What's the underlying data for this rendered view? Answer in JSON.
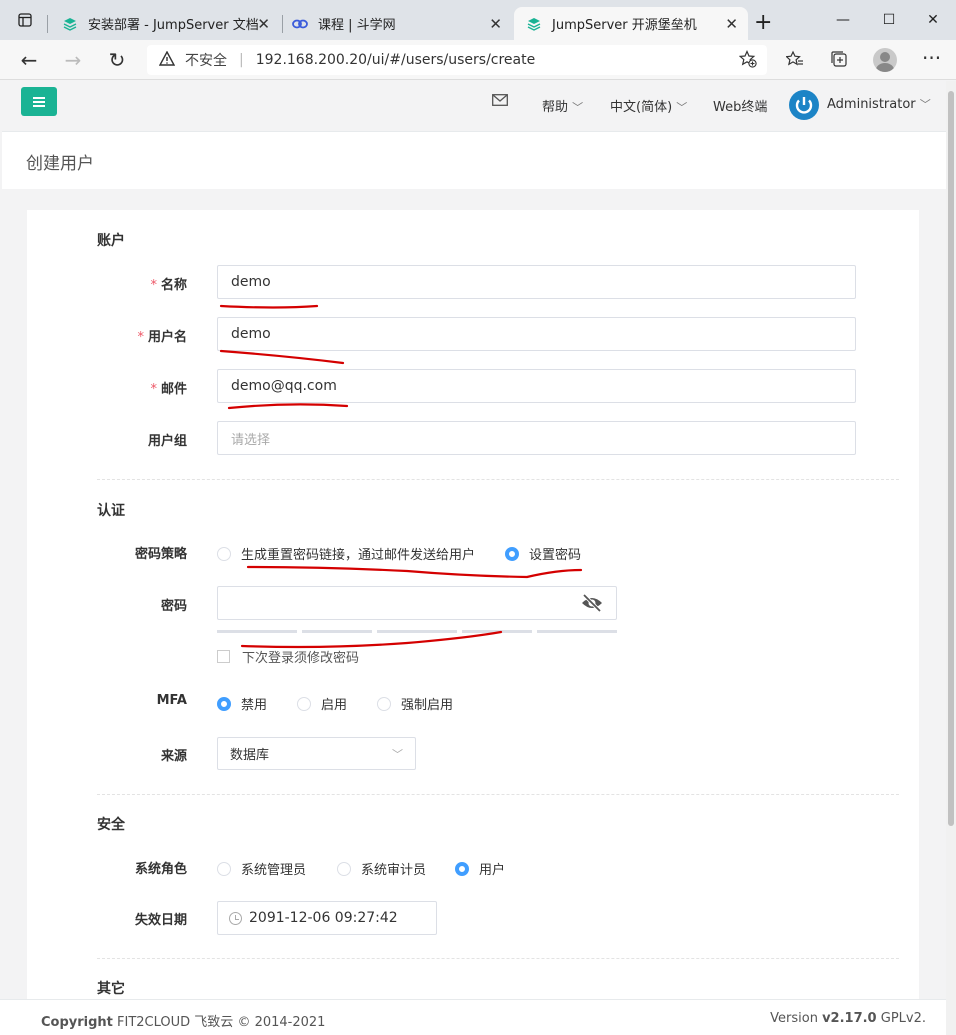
{
  "browser": {
    "tabs": [
      {
        "title": "安装部署 - JumpServer 文档",
        "icon": "jumpserver-doc-icon"
      },
      {
        "title": "课程 | 斗学网",
        "icon": "link-icon"
      },
      {
        "title": "JumpServer 开源堡垒机",
        "icon": "jumpserver-icon"
      }
    ],
    "security_label": "不安全",
    "url": "192.168.200.20/ui/#/users/users/create"
  },
  "topnav": {
    "help": "帮助",
    "lang": "中文(简体)",
    "web_terminal": "Web终端",
    "user": "Administrator"
  },
  "page_title": "创建用户",
  "sections": {
    "account": "账户",
    "auth": "认证",
    "security": "安全",
    "other": "其它"
  },
  "fields": {
    "name_label": "名称",
    "name_value": "demo",
    "username_label": "用户名",
    "username_value": "demo",
    "email_label": "邮件",
    "email_value": "demo@qq.com",
    "group_label": "用户组",
    "group_placeholder": "请选择",
    "password_strategy_label": "密码策略",
    "password_strategy_options": [
      "生成重置密码链接，通过邮件发送给用户",
      "设置密码"
    ],
    "password_strategy_selected": "设置密码",
    "password_label": "密码",
    "must_change_label": "下次登录须修改密码",
    "mfa_label": "MFA",
    "mfa_options": [
      "禁用",
      "启用",
      "强制启用"
    ],
    "mfa_selected": "禁用",
    "source_label": "来源",
    "source_value": "数据库",
    "role_label": "系统角色",
    "role_options": [
      "系统管理员",
      "系统审计员",
      "用户"
    ],
    "role_selected": "用户",
    "expire_label": "失效日期",
    "expire_value": "2091-12-06 09:27:42"
  },
  "footer": {
    "copyright_bold": "Copyright",
    "copyright_rest": " FIT2CLOUD 飞致云 © 2014-2021",
    "version_prefix": "Version ",
    "version": "v2.17.0",
    "license": " GPLv2."
  },
  "colors": {
    "accent": "#1ab394",
    "radio_active": "#409eff",
    "required": "#ed5565",
    "annotation": "#d40000"
  }
}
